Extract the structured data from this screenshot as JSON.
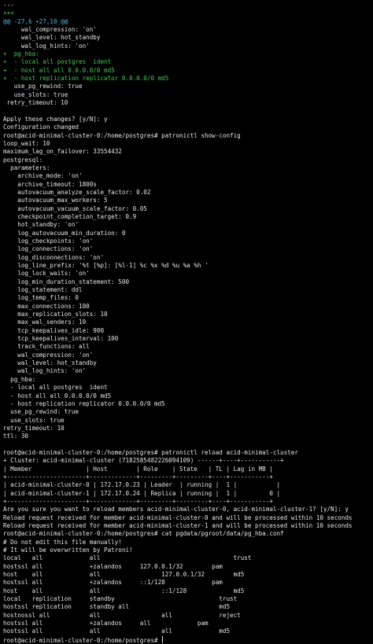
{
  "colors": {
    "background": "#000000",
    "text": "#e6e6e6",
    "diff_add": "#3fcf4a",
    "diff_hunk": "#49b8e6"
  },
  "lines": [
    {
      "text": "---",
      "color": "plain"
    },
    {
      "text": "+++",
      "color": "green"
    },
    {
      "text": "@@ -27,6 +27,10 @@",
      "color": "cyan"
    },
    {
      "text": "     wal_compression: 'on'",
      "color": "plain"
    },
    {
      "text": "     wal_level: hot_standby",
      "color": "plain"
    },
    {
      "text": "     wal_log_hints: 'on'",
      "color": "plain"
    },
    {
      "text": "+  pg_hba:",
      "color": "green"
    },
    {
      "text": "+  - local all postgres  ident",
      "color": "green"
    },
    {
      "text": "+  - host all all 0.0.0.0/0 md5",
      "color": "green"
    },
    {
      "text": "+  - host replication replicator 0.0.0.0/0 md5",
      "color": "green"
    },
    {
      "text": "   use_pg_rewind: true",
      "color": "plain"
    },
    {
      "text": "   use_slots: true",
      "color": "plain"
    },
    {
      "text": " retry_timeout: 10",
      "color": "plain"
    },
    {
      "text": "",
      "color": "plain"
    },
    {
      "text": "Apply these changes? [y/N]: y",
      "color": "plain"
    },
    {
      "text": "Configuration changed",
      "color": "plain"
    },
    {
      "text": "root@acid-minimal-cluster-0:/home/postgres# patronictl show-config",
      "color": "plain"
    },
    {
      "text": "loop_wait: 10",
      "color": "plain"
    },
    {
      "text": "maximum_lag_on_failover: 33554432",
      "color": "plain"
    },
    {
      "text": "postgresql:",
      "color": "plain"
    },
    {
      "text": "  parameters:",
      "color": "plain"
    },
    {
      "text": "    archive_mode: 'on'",
      "color": "plain"
    },
    {
      "text": "    archive_timeout: 1800s",
      "color": "plain"
    },
    {
      "text": "    autovacuum_analyze_scale_factor: 0.02",
      "color": "plain"
    },
    {
      "text": "    autovacuum_max_workers: 5",
      "color": "plain"
    },
    {
      "text": "    autovacuum_vacuum_scale_factor: 0.05",
      "color": "plain"
    },
    {
      "text": "    checkpoint_completion_target: 0.9",
      "color": "plain"
    },
    {
      "text": "    hot_standby: 'on'",
      "color": "plain"
    },
    {
      "text": "    log_autovacuum_min_duration: 0",
      "color": "plain"
    },
    {
      "text": "    log_checkpoints: 'on'",
      "color": "plain"
    },
    {
      "text": "    log_connections: 'on'",
      "color": "plain"
    },
    {
      "text": "    log_disconnections: 'on'",
      "color": "plain"
    },
    {
      "text": "    log_line_prefix: '%t [%p]: [%l-1] %c %x %d %u %a %h '",
      "color": "plain"
    },
    {
      "text": "    log_lock_waits: 'on'",
      "color": "plain"
    },
    {
      "text": "    log_min_duration_statement: 500",
      "color": "plain"
    },
    {
      "text": "    log_statement: ddl",
      "color": "plain"
    },
    {
      "text": "    log_temp_files: 0",
      "color": "plain"
    },
    {
      "text": "    max_connections: 100",
      "color": "plain"
    },
    {
      "text": "    max_replication_slots: 10",
      "color": "plain"
    },
    {
      "text": "    max_wal_senders: 10",
      "color": "plain"
    },
    {
      "text": "    tcp_keepalives_idle: 900",
      "color": "plain"
    },
    {
      "text": "    tcp_keepalives_interval: 100",
      "color": "plain"
    },
    {
      "text": "    track_functions: all",
      "color": "plain"
    },
    {
      "text": "    wal_compression: 'on'",
      "color": "plain"
    },
    {
      "text": "    wal_level: hot_standby",
      "color": "plain"
    },
    {
      "text": "    wal_log_hints: 'on'",
      "color": "plain"
    },
    {
      "text": "  pg_hba:",
      "color": "plain"
    },
    {
      "text": "  - local all postgres  ident",
      "color": "plain"
    },
    {
      "text": "  - host all all 0.0.0.0/0 md5",
      "color": "plain"
    },
    {
      "text": "  - host replication replicator 0.0.0.0/0 md5",
      "color": "plain"
    },
    {
      "text": "  use_pg_rewind: true",
      "color": "plain"
    },
    {
      "text": "  use_slots: true",
      "color": "plain"
    },
    {
      "text": "retry_timeout: 10",
      "color": "plain"
    },
    {
      "text": "ttl: 30",
      "color": "plain"
    },
    {
      "text": "",
      "color": "plain"
    },
    {
      "text": "root@acid-minimal-cluster-0:/home/postgres# patronictl reload acid-minimal-cluster",
      "color": "plain"
    },
    {
      "text": "+ Cluster: acid-minimal-cluster (7182585482226094109) ------+----+-----------+",
      "color": "plain"
    },
    {
      "text": "| Member               | Host        | Role    | State   | TL | Lag in MB |",
      "color": "plain"
    },
    {
      "text": "+----------------------+-------------+---------+---------+----+-----------+",
      "color": "plain"
    },
    {
      "text": "| acid-minimal-cluster-0 | 172.17.0.23 | Leader  | running |  1 |           |",
      "color": "plain"
    },
    {
      "text": "| acid-minimal-cluster-1 | 172.17.0.24 | Replica | running |  1 |         0 |",
      "color": "plain"
    },
    {
      "text": "+----------------------+-------------+---------+---------+----+-----------+",
      "color": "plain"
    },
    {
      "text": "Are you sure you want to reload members acid-minimal-cluster-0, acid-minimal-cluster-1? [y/N]: y",
      "color": "plain"
    },
    {
      "text": "Reload request received for member acid-minimal-cluster-0 and will be processed within 10 seconds",
      "color": "plain"
    },
    {
      "text": "Reload request received for member acid-minimal-cluster-1 and will be processed within 10 seconds",
      "color": "plain"
    },
    {
      "text": "root@acid-minimal-cluster-0:/home/postgres# cat pgdata/pgroot/data/pg_hba.conf",
      "color": "plain"
    },
    {
      "text": "# Do not edit this file manually!",
      "color": "plain"
    },
    {
      "text": "# It will be overwritten by Patroni!",
      "color": "plain"
    },
    {
      "text": "local   all             all                                     trust",
      "color": "plain"
    },
    {
      "text": "hostssl all             +zalandos     127.0.0.1/32        pam",
      "color": "plain"
    },
    {
      "text": "host    all             all                 127.0.0.1/32        md5",
      "color": "plain"
    },
    {
      "text": "hostssl all             +zalandos     ::1/128             pam",
      "color": "plain"
    },
    {
      "text": "host    all             all                 ::1/128             md5",
      "color": "plain"
    },
    {
      "text": "local   replication     standby                             trust",
      "color": "plain"
    },
    {
      "text": "hostssl replication     standby all                         md5",
      "color": "plain"
    },
    {
      "text": "hostnossl all           all                 all             reject",
      "color": "plain"
    },
    {
      "text": "hostssl all             +zalandos     all             pam",
      "color": "plain"
    },
    {
      "text": "hostssl all             all                 all             md5",
      "color": "plain"
    }
  ],
  "prompt_line": "root@acid-minimal-cluster-0:/home/postgres# "
}
